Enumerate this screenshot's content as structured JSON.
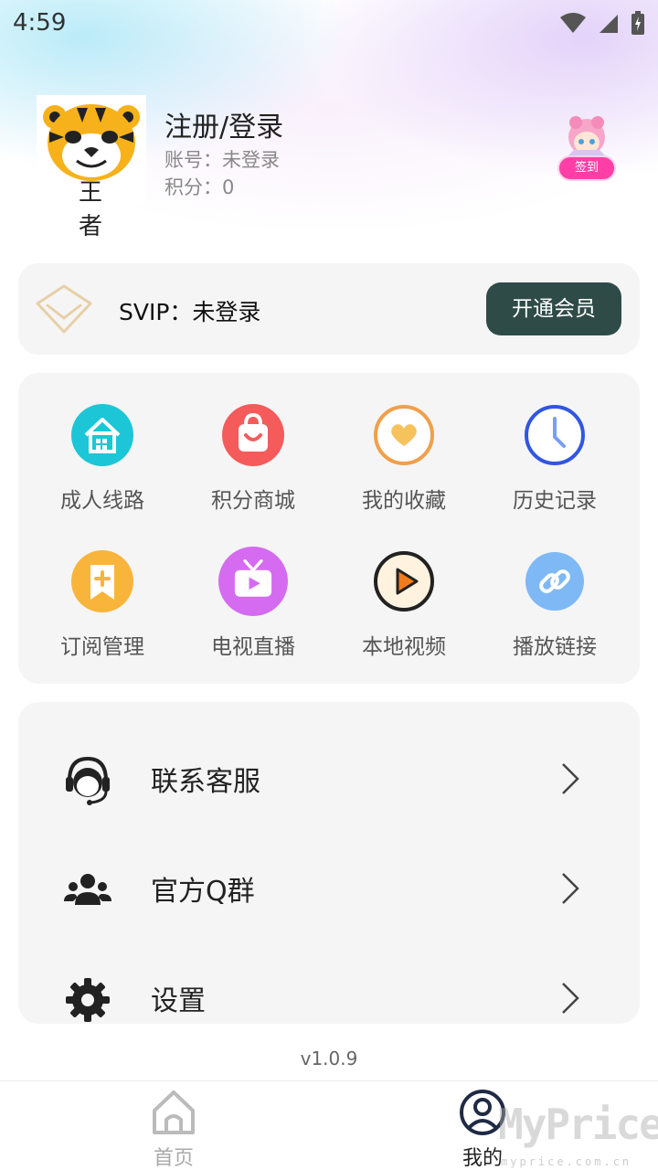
{
  "status_bar": {
    "time": "4:59"
  },
  "profile": {
    "avatar_text": "王 者",
    "name": "注册/登录",
    "account": "账号：未登录",
    "points": "积分：0",
    "checkin_label": "签到"
  },
  "vip": {
    "label": "SVIP：未登录",
    "button": "开通会员"
  },
  "grid": {
    "items": [
      {
        "label": "成人线路",
        "icon": "home-grid-icon",
        "color": "#1cc6d6"
      },
      {
        "label": "积分商城",
        "icon": "shopping-bag-icon",
        "color": "#f55b5b"
      },
      {
        "label": "我的收藏",
        "icon": "heart-icon",
        "color": "#f0a04a"
      },
      {
        "label": "历史记录",
        "icon": "clock-icon",
        "color": "#3156e0"
      },
      {
        "label": "订阅管理",
        "icon": "bookmark-plus-icon",
        "color": "#f9b43b"
      },
      {
        "label": "电视直播",
        "icon": "tv-icon",
        "color": "#d46bf0"
      },
      {
        "label": "本地视频",
        "icon": "play-circle-icon",
        "color": "#f27b1c"
      },
      {
        "label": "播放链接",
        "icon": "link-icon",
        "color": "#7fb9f5"
      }
    ]
  },
  "list": {
    "items": [
      {
        "label": "联系客服",
        "icon": "customer-service-icon"
      },
      {
        "label": "官方Q群",
        "icon": "group-icon"
      },
      {
        "label": "设置",
        "icon": "gear-icon"
      }
    ]
  },
  "version": "v1.0.9",
  "nav": {
    "home": "首页",
    "mine": "我的"
  },
  "watermark": {
    "main": "MyPrice",
    "sub": "myprice.com.cn"
  }
}
